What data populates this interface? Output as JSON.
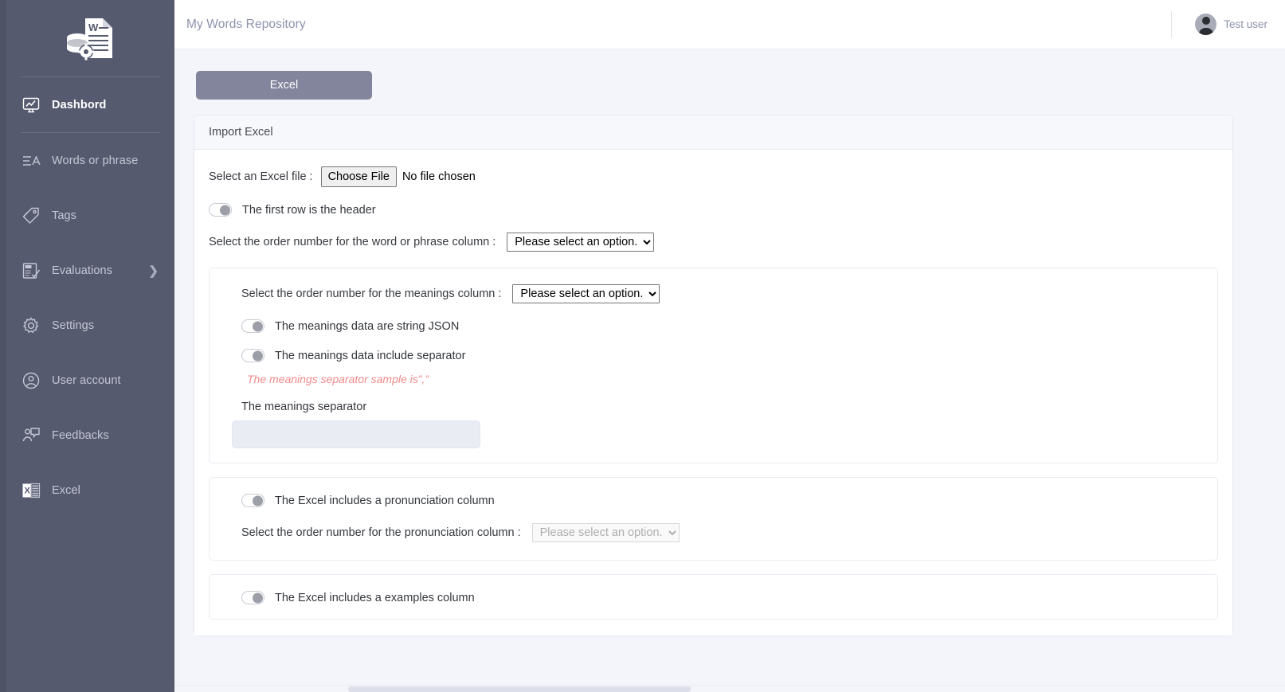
{
  "sidebar": {
    "logo_name": "word-document-database-logo",
    "items": [
      {
        "label": "Dashbord",
        "icon": "dashboard-monitor-icon",
        "active": true,
        "chevron": ""
      },
      {
        "label": "Words or phrase",
        "icon": "text-lines-a-icon",
        "active": false,
        "chevron": ""
      },
      {
        "label": "Tags",
        "icon": "tag-icon",
        "active": false,
        "chevron": ""
      },
      {
        "label": "Evaluations",
        "icon": "exam-checklist-icon",
        "active": false,
        "chevron": "❯"
      },
      {
        "label": "Settings",
        "icon": "gear-icon",
        "active": false,
        "chevron": ""
      },
      {
        "label": "User account",
        "icon": "user-circle-icon",
        "active": false,
        "chevron": ""
      },
      {
        "label": "Feedbacks",
        "icon": "feedback-person-icon",
        "active": false,
        "chevron": ""
      },
      {
        "label": "Excel",
        "icon": "excel-file-icon",
        "active": false,
        "chevron": ""
      }
    ]
  },
  "topbar": {
    "title": "My Words Repository",
    "user_name": "Test user",
    "avatar_icon": "user-avatar-icon"
  },
  "tabs": {
    "excel_label": "Excel"
  },
  "card": {
    "header": "Import Excel",
    "file_row": {
      "label": "Select an Excel file :",
      "button_label": "Choose File",
      "status": "No file chosen"
    },
    "first_row_header_toggle": {
      "label": "The first row is the header",
      "state": "off"
    },
    "word_column": {
      "label": "Select the order number for the word or phrase column :",
      "value": "Please select an option.",
      "disabled": false
    },
    "meanings_section": {
      "column_label": "Select the order number for the meanings column :",
      "column_value": "Please select an option.",
      "column_disabled": false,
      "json_toggle_label": "The meanings data are string JSON",
      "json_toggle_state": "off",
      "separator_toggle_label": "The meanings data include separator",
      "separator_toggle_state": "off",
      "hint": "The meanings separator sample is”,”",
      "separator_field_label": "The meanings separator",
      "separator_field_value": "",
      "separator_field_placeholder": ""
    },
    "pronunciation_section": {
      "toggle_label": "The Excel includes a pronunciation column",
      "toggle_state": "off",
      "column_label": "Select the order number for the pronunciation column :",
      "column_value": "Please select an option.",
      "column_disabled": true
    },
    "examples_section": {
      "toggle_label": "The Excel includes a examples column",
      "toggle_state": "off"
    }
  },
  "colors": {
    "sidebar_bg": "#565a6e",
    "page_bg": "#f4f5fa",
    "tab_button": "#82859c",
    "hint_red": "#f08a8a",
    "muted_text": "#8e93ad"
  }
}
